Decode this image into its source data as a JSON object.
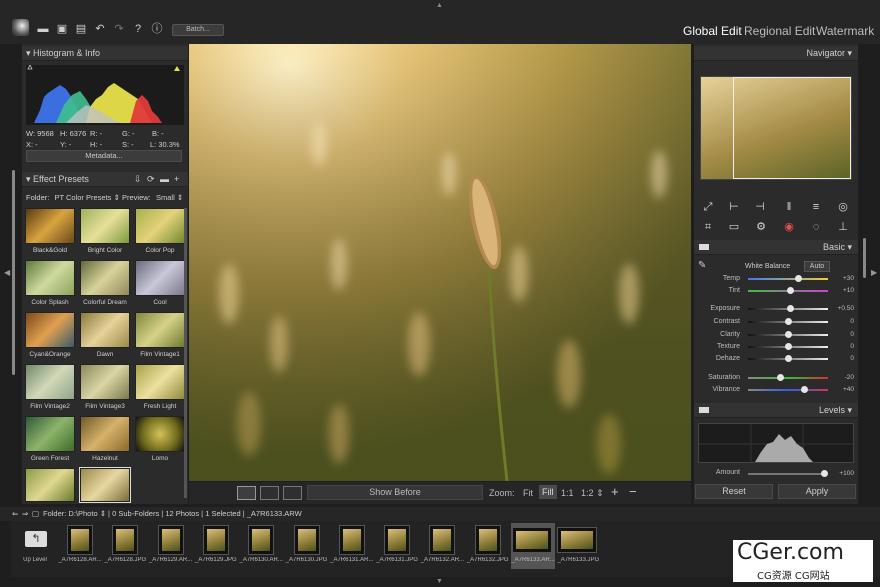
{
  "toolbar": {
    "batch_label": "Batch..."
  },
  "modes": {
    "global": "Global Edit",
    "regional": "Regional Edit",
    "watermark": "Watermark"
  },
  "histogram": {
    "title": "Histogram & Info",
    "row1": [
      "W: 9568",
      "H: 6376",
      "R: -",
      "G: -",
      "B: -"
    ],
    "row2": [
      "X: -",
      "Y: -",
      "H: -",
      "S: -",
      "L: 30.3%"
    ],
    "metadata_label": "Metadata..."
  },
  "presets": {
    "title": "Effect Presets",
    "folder_label": "Folder:",
    "folder_value": "PT Color Presets ⇕",
    "preview_label": "Preview:",
    "preview_value": "Small ⇕",
    "items": [
      "Black&Gold",
      "Bright Color",
      "Color Pop",
      "Color Splash",
      "Colorful Dream",
      "Cool",
      "Cyan&Orange",
      "Dawn",
      "Film Vintage1",
      "Film Vintage2",
      "Film Vintage3",
      "Fresh Light",
      "Green Forest",
      "Hazelnut",
      "Lomo",
      "",
      ""
    ]
  },
  "bottom": {
    "show_before": "Show Before",
    "zoom_label": "Zoom:",
    "fit": "Fit",
    "fill": "Fill",
    "one": "1:1",
    "two": "1:2 ⇕",
    "plus": "+",
    "minus": "−"
  },
  "navigator": {
    "title": "Navigator ▾"
  },
  "basic": {
    "title": "Basic ▾",
    "wb_label": "White Balance",
    "wb_auto": "Auto",
    "sliders": [
      {
        "label": "Temp",
        "value": "+30",
        "pos": 0.62
      },
      {
        "label": "Tint",
        "value": "+10",
        "pos": 0.53
      },
      {
        "label": "Exposure",
        "value": "+0.50",
        "pos": 0.53
      },
      {
        "label": "Contrast",
        "value": "0",
        "pos": 0.5
      },
      {
        "label": "Clarity",
        "value": "0",
        "pos": 0.5
      },
      {
        "label": "Texture",
        "value": "0",
        "pos": 0.5
      },
      {
        "label": "Dehaze",
        "value": "0",
        "pos": 0.5
      },
      {
        "label": "Saturation",
        "value": "-20",
        "pos": 0.4
      },
      {
        "label": "Vibrance",
        "value": "+40",
        "pos": 0.7
      }
    ]
  },
  "levels": {
    "title": "Levels ▾",
    "amount_label": "Amount",
    "amount_value": "+100",
    "amount_pos": 1.0
  },
  "actions": {
    "reset": "Reset",
    "apply": "Apply"
  },
  "pathbar": {
    "text": "Folder: D:\\Photo ⇕ | 0 Sub-Folders | 12 Photos | 1 Selected | _A7R6133.ARW"
  },
  "film": {
    "uplevel": "Up Level",
    "items": [
      "_A7R6128.AR...",
      "_A7R6128.JPG",
      "_A7R6129.AR...",
      "_A7R6129.JPG",
      "_A7R6130.AR...",
      "_A7R6130.JPG",
      "_A7R6131.AR...",
      "_A7R6131.JPG",
      "_A7R6132.AR...",
      "_A7R6132.JPG",
      "_A7R6133.AR...",
      "_A7R6133.JPG"
    ],
    "selected_index": 10
  },
  "watermark": {
    "big": "CGer.com",
    "small": "CG资源 CG网站"
  }
}
